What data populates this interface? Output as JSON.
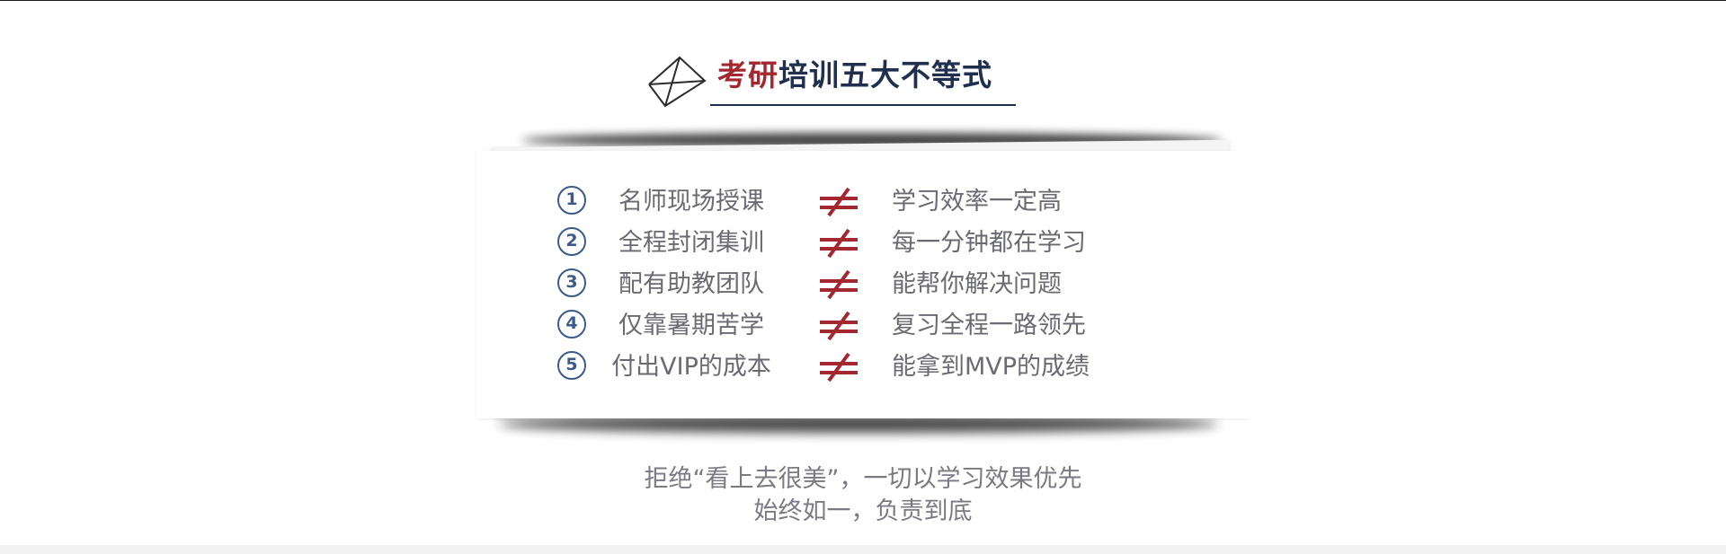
{
  "title": {
    "accent": "考研",
    "rest": "培训五大不等式",
    "icon": "paper-plane-outline-icon"
  },
  "rows": [
    {
      "num": "1",
      "left": "名师现场授课",
      "right": "学习效率一定高"
    },
    {
      "num": "2",
      "left": "全程封闭集训",
      "right": "每一分钟都在学习"
    },
    {
      "num": "3",
      "left": "配有助教团队",
      "right": "能帮你解决问题"
    },
    {
      "num": "4",
      "left": "仅靠暑期苦学",
      "right": "复习全程一路领先"
    },
    {
      "num": "5",
      "left": "付出VIP的成本",
      "right": "能拿到MVP的成绩"
    }
  ],
  "neq_symbol": "not-equal-icon",
  "slogan": {
    "line1": "拒绝“看上去很美”，一切以学习效果优先",
    "line2": "始终如一，负责到底"
  },
  "colors": {
    "accent_red": "#a3272f",
    "navy": "#1f2f4d",
    "number_blue": "#3a5a8a",
    "text_gray": "#6a6a72"
  }
}
